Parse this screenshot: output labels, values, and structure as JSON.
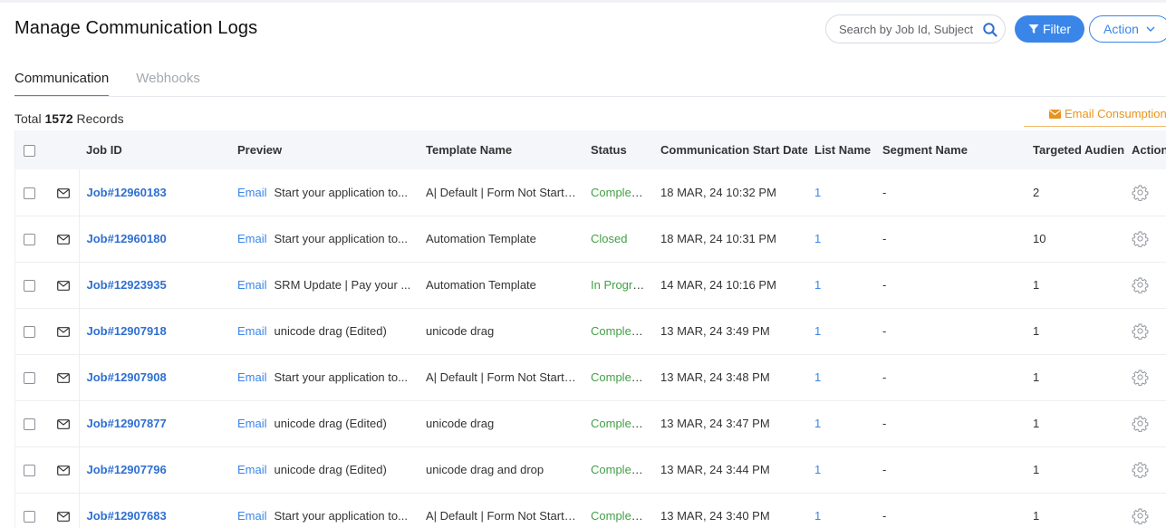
{
  "page": {
    "title": "Manage Communication Logs"
  },
  "search": {
    "placeholder": "Search by Job Id, Subject",
    "icon": "search-icon"
  },
  "toolbar": {
    "filter_label": "Filter",
    "action_label": "Action"
  },
  "tabs": [
    {
      "label": "Communication",
      "active": true
    },
    {
      "label": "Webhooks",
      "active": false
    }
  ],
  "summary": {
    "prefix": "Total",
    "count": "1572",
    "suffix": "Records"
  },
  "email_consumption": {
    "label": "Email Consumption"
  },
  "table": {
    "columns": [
      "Job ID",
      "Preview",
      "Template Name",
      "Status",
      "Communication Start Date",
      "List Name",
      "Segment Name",
      "Targeted Audience",
      "Action"
    ],
    "rows": [
      {
        "job_id": "Job#12960183",
        "channel": "Email",
        "preview": "Start your application to...",
        "template": "A| Default | Form Not Started",
        "status": "Completed",
        "date": "18 MAR, 24 10:32 PM",
        "list": "1",
        "segment": "-",
        "audience": "2"
      },
      {
        "job_id": "Job#12960180",
        "channel": "Email",
        "preview": "Start your application to...",
        "template": "Automation Template",
        "status": "Closed",
        "date": "18 MAR, 24 10:31 PM",
        "list": "1",
        "segment": "-",
        "audience": "10"
      },
      {
        "job_id": "Job#12923935",
        "channel": "Email",
        "preview": "SRM Update | Pay your ...",
        "template": "Automation Template",
        "status": "In Progress",
        "date": "14 MAR, 24 10:16 PM",
        "list": "1",
        "segment": "-",
        "audience": "1"
      },
      {
        "job_id": "Job#12907918",
        "channel": "Email",
        "preview": "unicode drag (Edited)",
        "template": "unicode drag",
        "status": "Completed",
        "date": "13 MAR, 24 3:49 PM",
        "list": "1",
        "segment": "-",
        "audience": "1"
      },
      {
        "job_id": "Job#12907908",
        "channel": "Email",
        "preview": "Start your application to...",
        "template": "A| Default | Form Not Started",
        "status": "Completed",
        "date": "13 MAR, 24 3:48 PM",
        "list": "1",
        "segment": "-",
        "audience": "1"
      },
      {
        "job_id": "Job#12907877",
        "channel": "Email",
        "preview": "unicode drag (Edited)",
        "template": "unicode drag",
        "status": "Completed",
        "date": "13 MAR, 24 3:47 PM",
        "list": "1",
        "segment": "-",
        "audience": "1"
      },
      {
        "job_id": "Job#12907796",
        "channel": "Email",
        "preview": "unicode drag (Edited)",
        "template": "unicode drag and drop",
        "status": "Completed",
        "date": "13 MAR, 24 3:44 PM",
        "list": "1",
        "segment": "-",
        "audience": "1"
      },
      {
        "job_id": "Job#12907683",
        "channel": "Email",
        "preview": "Start your application to...",
        "template": "A| Default | Form Not Started",
        "status": "Completed",
        "date": "13 MAR, 24 3:40 PM",
        "list": "1",
        "segment": "-",
        "audience": "1"
      }
    ]
  },
  "colors": {
    "accent": "#3a86e8",
    "status_green": "#43a047",
    "consumption_orange": "#e8931d"
  }
}
